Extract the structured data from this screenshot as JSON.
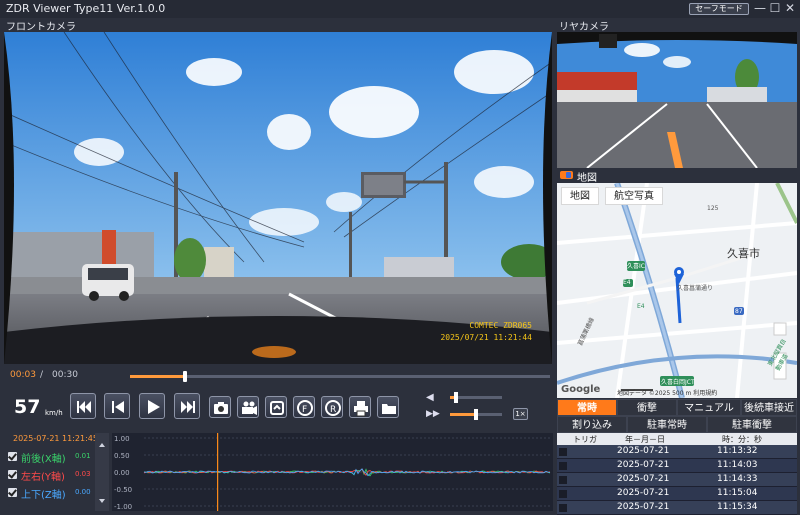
{
  "app": {
    "title": "ZDR Viewer Type11 Ver.1.0.0",
    "safe_mode_label": "セーフモード"
  },
  "window_controls": {
    "minimize": "—",
    "maximize": "☐",
    "close": "✕"
  },
  "front_camera": {
    "label": "フロントカメラ",
    "overlay_brand": "COMTEC  ZDR065",
    "overlay_datetime": "2025/07/21  11:21:44"
  },
  "rear_camera": {
    "label": "リヤカメラ"
  },
  "map": {
    "header_label": "地図",
    "tabs": [
      "地図",
      "航空写真"
    ],
    "city_label": "久喜市",
    "places": [
      "久喜IC",
      "久喜白岡JCT"
    ],
    "roads": [
      "E4",
      "E4",
      "菖蒲栗橋線",
      "久喜菖蒲通り",
      "87",
      "125",
      "東北縦貫自動車道"
    ],
    "attribution": "地図データ ©2025",
    "scale": "500 m",
    "terms": "利用規約",
    "logo": "Google"
  },
  "playback": {
    "current_time": "00:03",
    "separator": "/",
    "total_time": "00:30",
    "progress": 0.13
  },
  "speed": {
    "value": "57",
    "unit": "km/h"
  },
  "controls": {
    "buttons": [
      "skip-previous",
      "step-back",
      "play",
      "skip-next"
    ],
    "tools": [
      "snapshot",
      "video-export",
      "rotate",
      "fullscreen",
      "rear-mode",
      "print",
      "folder"
    ]
  },
  "volume": {
    "level": 0.12
  },
  "rate": {
    "level": 0.5,
    "badge": "1×"
  },
  "sensor": {
    "timestamp": "2025-07-21 11:21:45",
    "axes": [
      {
        "label": "前後(X軸)",
        "value": "0.01",
        "color": "#3ad36b"
      },
      {
        "label": "左右(Y軸)",
        "value": "0.03",
        "color": "#ff4a4a"
      },
      {
        "label": "上下(Z軸)",
        "value": "0.00",
        "color": "#4aa8ff"
      }
    ]
  },
  "chart_data": {
    "type": "line",
    "ylim": [
      -1.0,
      1.0
    ],
    "yticks": [
      "1.00",
      "0.50",
      "0.00",
      "-0.50",
      "-1.00"
    ],
    "cursor_fraction": 0.18,
    "series_colors": [
      "#3ad36b",
      "#ff4a4a",
      "#4aa8ff"
    ]
  },
  "events": {
    "tabs_row1": [
      "常時",
      "衝撃",
      "マニュアル",
      "後続車接近"
    ],
    "tabs_row2": [
      "割り込み",
      "駐車常時",
      "駐車衝撃"
    ],
    "active_tab": "常時",
    "columns": [
      "トリガ",
      "年－月－日",
      "時：分：秒"
    ],
    "rows": [
      {
        "date": "2025-07-21",
        "time": "11:13:32"
      },
      {
        "date": "2025-07-21",
        "time": "11:14:03"
      },
      {
        "date": "2025-07-21",
        "time": "11:14:33"
      },
      {
        "date": "2025-07-21",
        "time": "11:15:04"
      },
      {
        "date": "2025-07-21",
        "time": "11:15:34"
      }
    ]
  }
}
